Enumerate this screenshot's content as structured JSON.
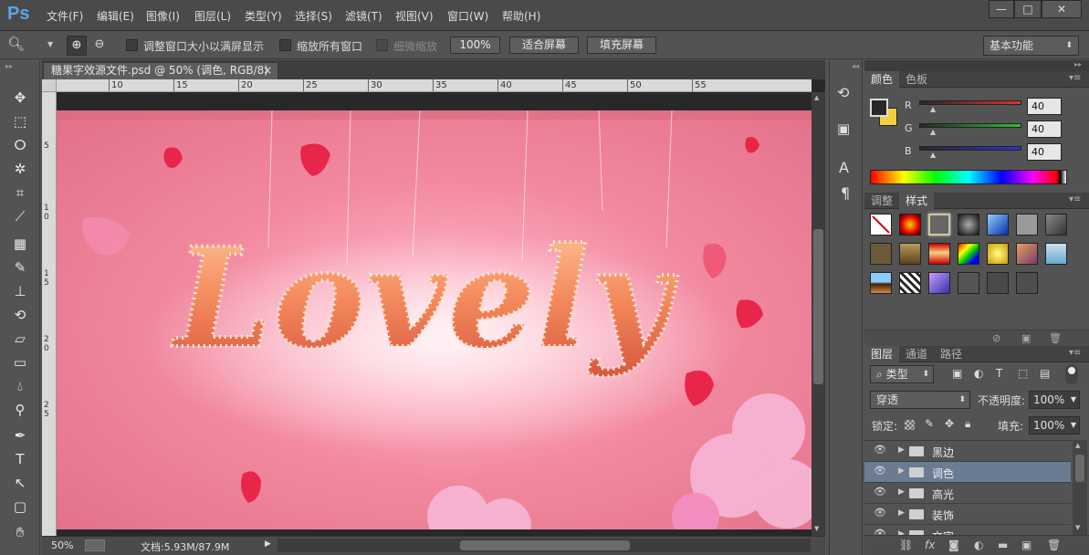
{
  "app": {
    "logo": "Ps"
  },
  "menu": [
    "文件(F)",
    "编辑(E)",
    "图像(I)",
    "图层(L)",
    "类型(Y)",
    "选择(S)",
    "滤镜(T)",
    "视图(V)",
    "窗口(W)",
    "帮助(H)"
  ],
  "window_controls": [
    "—",
    "□",
    "✕"
  ],
  "options": {
    "resize_label": "调整窗口大小以满屏显示",
    "zoom_all_label": "缩放所有窗口",
    "scrubby_label": "细微缩放",
    "zoom_value": "100%",
    "fit_screen": "适合屏幕",
    "fill_screen": "填充屏幕",
    "workspace": "基本功能"
  },
  "document": {
    "tab_title": "糖果字效源文件.psd @ 50% (调色, RGB/8)",
    "close_glyph": "×",
    "artwork_text": "Lovely",
    "ruler_h": [
      "10",
      "15",
      "20",
      "25",
      "30",
      "35",
      "40",
      "45",
      "50",
      "55"
    ],
    "ruler_v": [
      "5",
      "1\n0",
      "1\n5",
      "2\n0",
      "2\n5"
    ]
  },
  "status": {
    "zoom": "50%",
    "doc_info": "文档:5.93M/87.9M"
  },
  "color_panel": {
    "tabs": [
      "颜色",
      "色板"
    ],
    "channels": [
      {
        "label": "R",
        "value": "40",
        "color": "#e03030"
      },
      {
        "label": "G",
        "value": "40",
        "color": "#2ea82e"
      },
      {
        "label": "B",
        "value": "40",
        "color": "#3030d8"
      }
    ],
    "foreground": "#282828",
    "background": "#f0d040"
  },
  "styles_panel": {
    "tabs": [
      "调整",
      "样式"
    ]
  },
  "layers_panel": {
    "tabs": [
      "图层",
      "通道",
      "路径"
    ],
    "filter_kind": "类型",
    "blend_mode": "穿透",
    "opacity_label": "不透明度:",
    "opacity_value": "100%",
    "lock_label": "锁定:",
    "fill_label": "填充:",
    "fill_value": "100%",
    "layers": [
      {
        "name": "黑边",
        "selected": false
      },
      {
        "name": "调色",
        "selected": true
      },
      {
        "name": "高光",
        "selected": false
      },
      {
        "name": "装饰",
        "selected": false
      },
      {
        "name": "文字",
        "selected": false
      }
    ]
  }
}
